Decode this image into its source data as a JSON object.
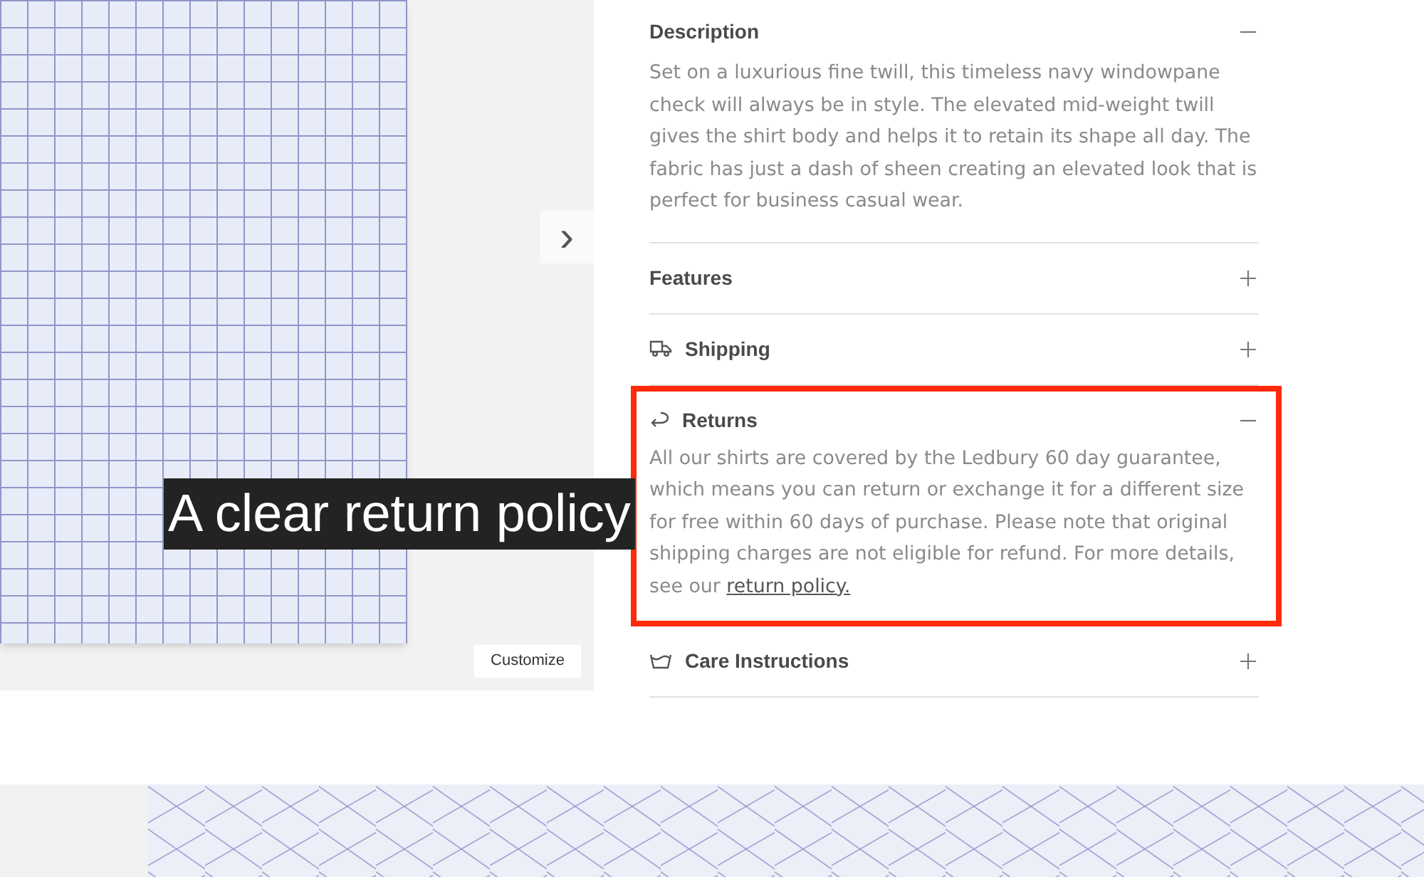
{
  "gallery": {
    "next_button": "›",
    "customize_button": "Customize"
  },
  "caption": "A clear return policy",
  "sections": [
    {
      "title": "Description",
      "kind": "plain",
      "expanded": true,
      "highlighted": false,
      "body": "Set on a luxurious fine twill, this timeless navy windowpane check will always be in style. The elevated mid-weight twill gives the shirt body and helps it to retain its shape all day. The fabric has just a dash of sheen creating an elevated look that is perfect for business casual wear."
    },
    {
      "title": "Features",
      "kind": "plain",
      "expanded": false,
      "highlighted": false
    },
    {
      "title": "Shipping",
      "kind": "shipping",
      "expanded": false,
      "highlighted": false
    },
    {
      "title": "Returns",
      "kind": "returns",
      "expanded": true,
      "highlighted": true,
      "body": "All our shirts are covered by the Ledbury 60 day guarantee, which means you can return or exchange it for a different size for free within 60 days of purchase. Please note that original shipping charges are not eligible for refund. For more details, see our",
      "link": "return policy."
    },
    {
      "title": "Care Instructions",
      "kind": "care",
      "expanded": false,
      "highlighted": false
    }
  ]
}
